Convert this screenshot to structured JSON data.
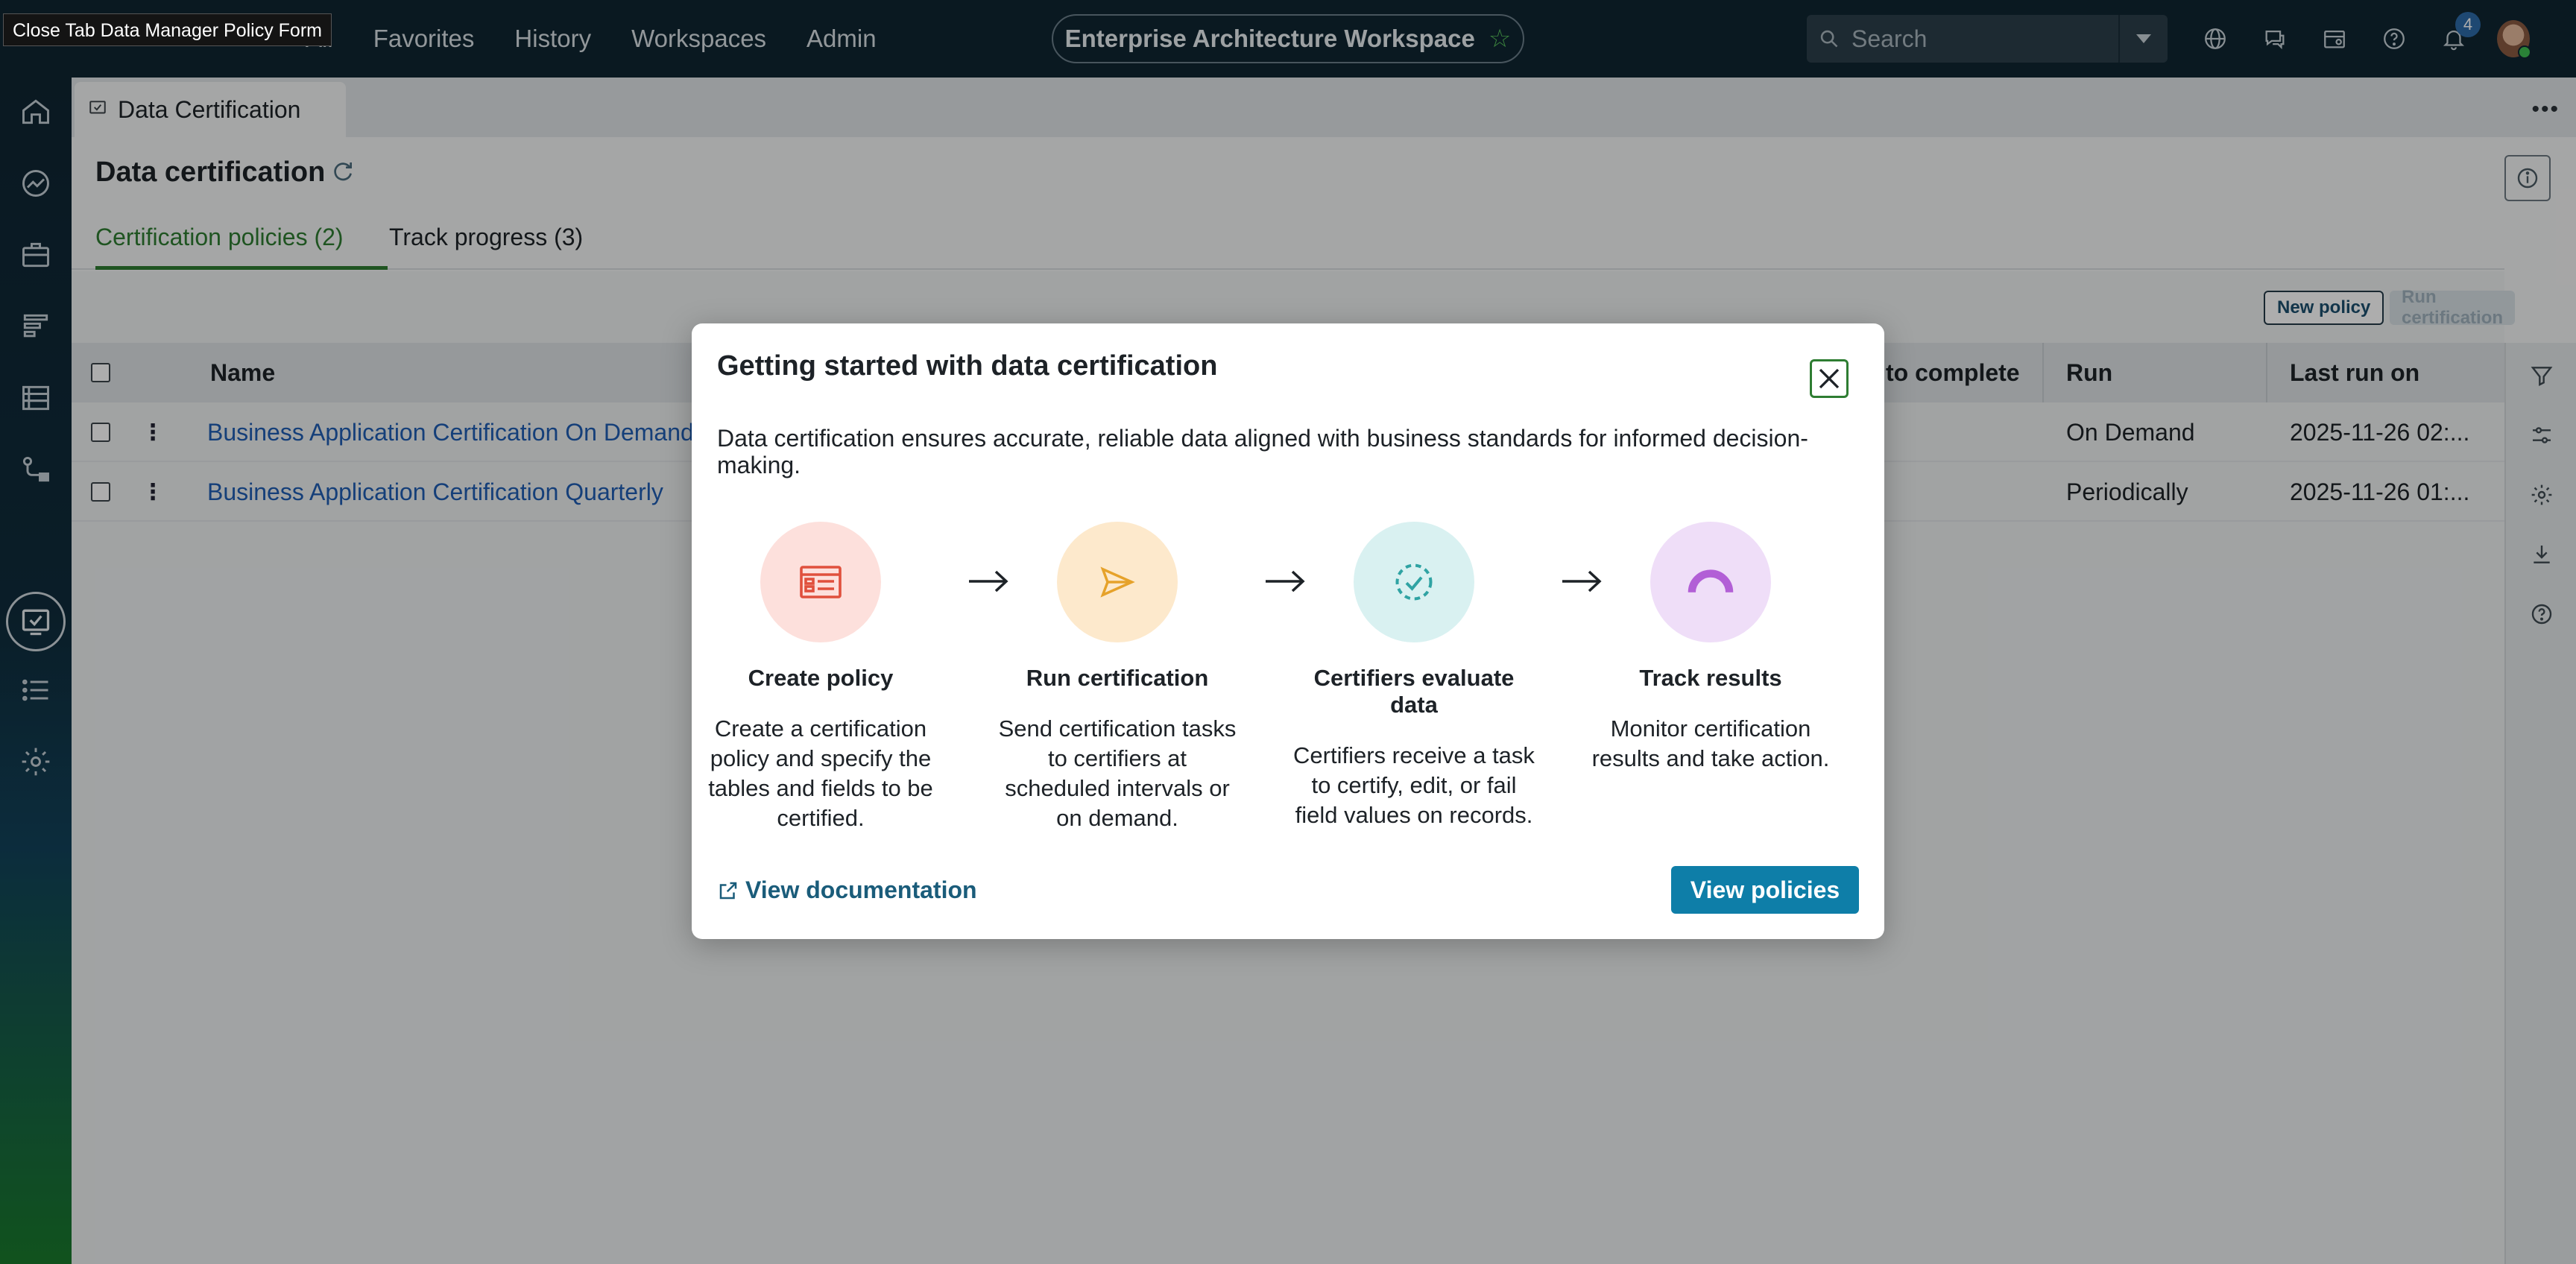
{
  "tooltip": "Close Tab Data Manager Policy Form",
  "nav": {
    "all": "All",
    "favorites": "Favorites",
    "history": "History",
    "workspaces": "Workspaces",
    "admin": "Admin"
  },
  "workspace_title": "Enterprise Architecture Workspace",
  "search": {
    "placeholder": "Search"
  },
  "notifications_count": "4",
  "tab": {
    "label": "Data Certification"
  },
  "page": {
    "title": "Data certification"
  },
  "subtabs": {
    "policies": "Certification policies (2)",
    "progress": "Track progress (3)"
  },
  "actions": {
    "new_policy": "New policy",
    "run_certification": "Run certification"
  },
  "table": {
    "headers": {
      "name": "Name",
      "to_complete": "to complete",
      "run": "Run",
      "last_run": "Last run on"
    },
    "rows": [
      {
        "name": "Business Application Certification On Demand",
        "run": "On Demand",
        "last_run": "2025-11-26 02:..."
      },
      {
        "name": "Business Application Certification Quarterly",
        "run": "Periodically",
        "last_run": "2025-11-26 01:..."
      }
    ]
  },
  "modal": {
    "title": "Getting started with data certification",
    "description": "Data certification ensures accurate, reliable data aligned with business standards for informed decision-making.",
    "steps": [
      {
        "title": "Create policy",
        "text": "Create a certification policy and specify the tables and fields to be certified."
      },
      {
        "title": "Run certification",
        "text": "Send certification tasks to certifiers at scheduled intervals or on demand."
      },
      {
        "title": "Certifiers evaluate data",
        "text": "Certifiers receive a task to certify, edit, or fail field values on records."
      },
      {
        "title": "Track results",
        "text": "Monitor certification results and take action."
      }
    ],
    "doc_link": "View documentation",
    "primary_button": "View policies"
  },
  "colors": {
    "topbar": "#0f2532",
    "accent_green": "#2e7d32",
    "link_blue": "#1f5db3",
    "primary_button": "#0e7ea8",
    "step1_bg": "#fde0dc",
    "step2_bg": "#fde9cc",
    "step3_bg": "#d9f1f1",
    "step4_bg": "#efdef8"
  },
  "icons": {
    "left_rail": [
      "home-icon",
      "analytics-icon",
      "briefcase-icon",
      "roadmap-icon",
      "data-list-icon",
      "workflow-icon",
      "certification-icon",
      "list-icon",
      "settings-icon"
    ],
    "right_rail": [
      "filter-icon",
      "sliders-icon",
      "gear-icon",
      "download-icon",
      "help-icon"
    ]
  }
}
